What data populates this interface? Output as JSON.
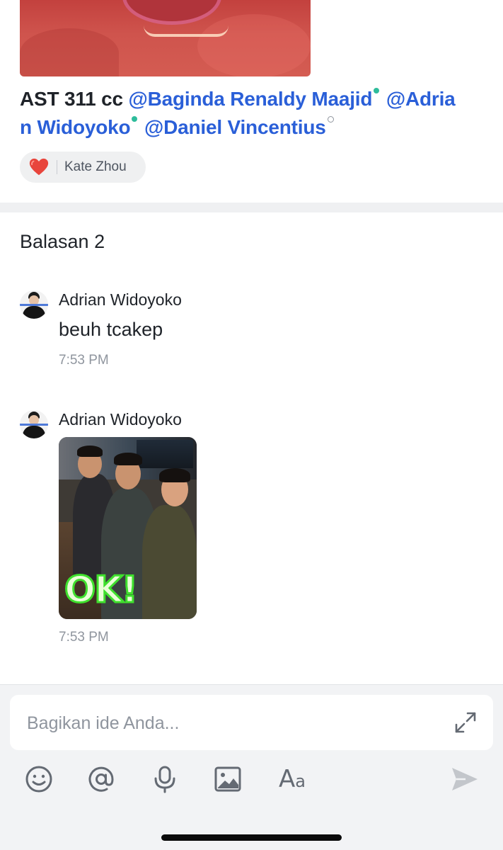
{
  "post": {
    "message_prefix": "AST 311 cc",
    "mentions": [
      {
        "text": "@Baginda Renaldy Maajid",
        "status": "online"
      },
      {
        "text": "@Adria",
        "status": "none"
      },
      {
        "text": "n Widoyoko",
        "status": "online"
      },
      {
        "text": "@Daniel Vincentius",
        "status": "offline"
      }
    ],
    "reaction": {
      "emoji": "heart",
      "user": "Kate Zhou"
    }
  },
  "replies": {
    "title": "Balasan 2",
    "items": [
      {
        "author": "Adrian Widoyoko",
        "text": "beuh tcakep",
        "time": "7:53 PM"
      },
      {
        "author": "Adrian Widoyoko",
        "image_overlay_text": "OK!",
        "time": "7:53 PM"
      }
    ]
  },
  "composer": {
    "placeholder": "Bagikan ide Anda...",
    "value": ""
  },
  "toolbar": {
    "items": [
      "emoji-icon",
      "mention-icon",
      "microphone-icon",
      "image-icon",
      "text-format-icon",
      "send-icon"
    ],
    "format_label_big": "A",
    "format_label_small": "a"
  },
  "colors": {
    "mention": "#2a5fd8",
    "online_dot": "#2ebc9b",
    "secondary_text": "#8f959e",
    "composer_bg": "#f2f3f5"
  }
}
